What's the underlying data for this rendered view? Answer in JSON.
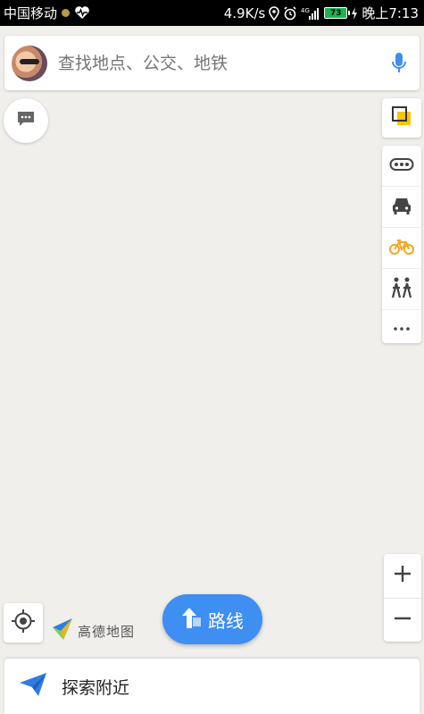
{
  "status_bar": {
    "carrier": "中国移动",
    "net_speed": "4.9K/s",
    "signal_type": "4G",
    "battery": "73",
    "time": "晚上7:13"
  },
  "search": {
    "placeholder": "查找地点、公交、地铁"
  },
  "colors": {
    "accent": "#3f8ef2",
    "map_bg": "#f0efec",
    "bike_orange": "#f5a623",
    "layer_yellow": "#f7c600"
  },
  "transport_modes": [
    "traffic-icon",
    "taxi-icon",
    "bike-icon",
    "walk-icon",
    "more-icon"
  ],
  "brand": {
    "name": "高德地图"
  },
  "route_button": {
    "label": "路线"
  },
  "bottom": {
    "label": "探索附近"
  }
}
